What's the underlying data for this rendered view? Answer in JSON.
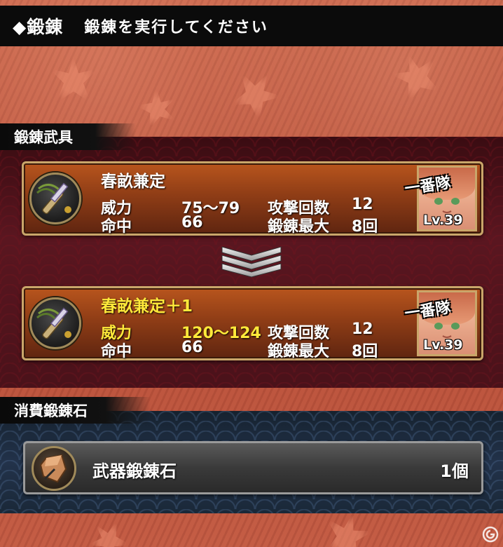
{
  "header": {
    "title": "◆鍛錬",
    "subtitle": "鍛錬を実行してください"
  },
  "weapon_section": {
    "label": "鍛錬武具",
    "current": {
      "name": "春畝兼定",
      "stats": {
        "power_label": "威力",
        "power_value": "75〜79",
        "hit_label": "命中",
        "hit_value": "66",
        "attacks_label": "攻撃回数",
        "attacks_value": "12",
        "max_label": "鍛錬最大",
        "max_value": "8回"
      },
      "character": {
        "badge": "一番隊",
        "level": "Lv.39"
      }
    },
    "result": {
      "name": "春畝兼定＋1",
      "stats": {
        "power_label": "威力",
        "power_value": "120〜124",
        "hit_label": "命中",
        "hit_value": "66",
        "attacks_label": "攻撃回数",
        "attacks_value": "12",
        "max_label": "鍛錬最大",
        "max_value": "8回"
      },
      "character": {
        "badge": "一番隊",
        "level": "Lv.39"
      }
    },
    "arrow_icon": "chevron-down-triple-icon"
  },
  "stone_section": {
    "label": "消費鍛錬石",
    "item": {
      "name": "武器鍛錬石",
      "count": "1個",
      "icon": "forge-stone-icon"
    }
  },
  "colors": {
    "highlight": "#ffe93a",
    "card_gold_border": "#c9a66a",
    "card_orange": "#b8551d",
    "header_bg": "#0b0b0b"
  }
}
